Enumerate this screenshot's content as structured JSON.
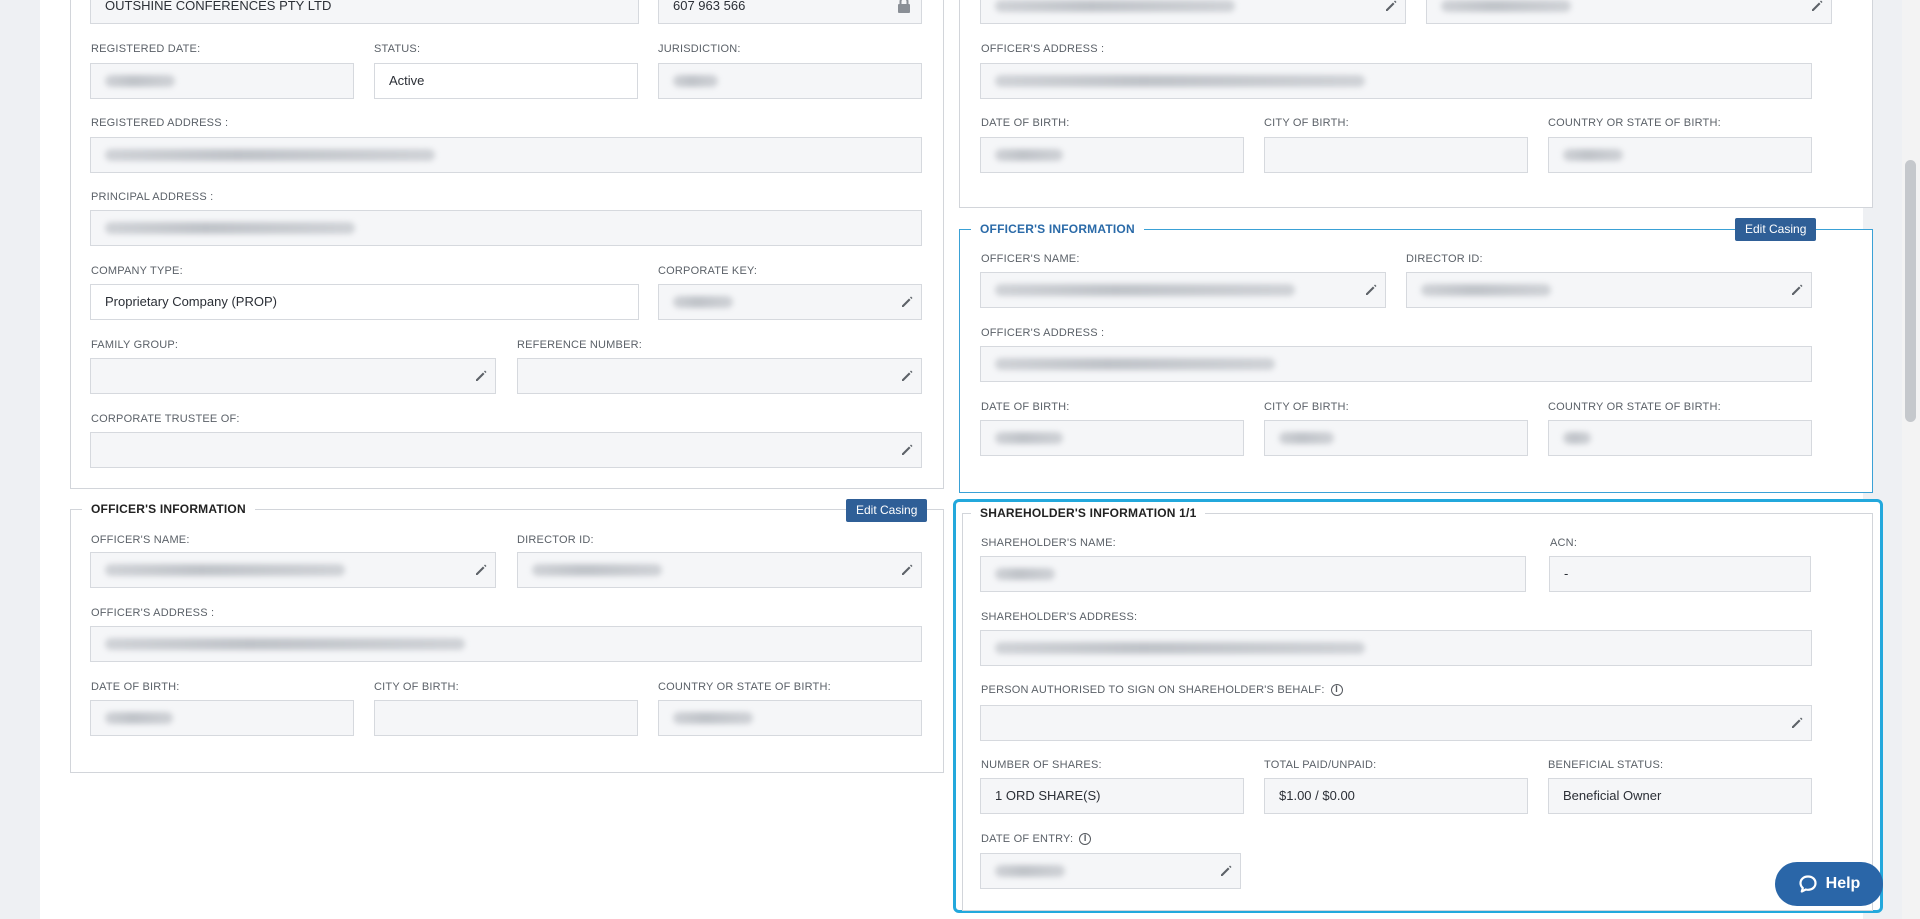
{
  "company": {
    "name_value": "OUTSHINE CONFERENCES PTY LTD",
    "acn_value": "607 963 566",
    "registered_date_label": "REGISTERED DATE:",
    "status_label": "STATUS:",
    "status_value": "Active",
    "jurisdiction_label": "JURISDICTION:",
    "registered_address_label": "REGISTERED ADDRESS :",
    "principal_address_label": "PRINCIPAL ADDRESS :",
    "company_type_label": "COMPANY TYPE:",
    "company_type_value": "Proprietary Company (PROP)",
    "corporate_key_label": "CORPORATE KEY:",
    "family_group_label": "FAMILY GROUP:",
    "reference_number_label": "REFERENCE NUMBER:",
    "corporate_trustee_label": "CORPORATE TRUSTEE OF:"
  },
  "officer_left": {
    "legend": "OFFICER'S INFORMATION",
    "edit_casing": "Edit Casing",
    "name_label": "OFFICER'S NAME:",
    "director_id_label": "DIRECTOR ID:",
    "address_label": "OFFICER'S ADDRESS :",
    "dob_label": "DATE OF BIRTH:",
    "city_label": "CITY OF BIRTH:",
    "country_label": "COUNTRY OR STATE OF BIRTH:"
  },
  "officer_top_right": {
    "address_label": "OFFICER'S ADDRESS :",
    "dob_label": "DATE OF BIRTH:",
    "city_label": "CITY OF BIRTH:",
    "country_label": "COUNTRY OR STATE OF BIRTH:"
  },
  "officer_right": {
    "legend": "OFFICER'S INFORMATION",
    "edit_casing": "Edit Casing",
    "name_label": "OFFICER'S NAME:",
    "director_id_label": "DIRECTOR ID:",
    "address_label": "OFFICER'S ADDRESS :",
    "dob_label": "DATE OF BIRTH:",
    "city_label": "CITY OF BIRTH:",
    "country_label": "COUNTRY OR STATE OF BIRTH:"
  },
  "shareholder": {
    "legend": "SHAREHOLDER'S INFORMATION 1/1",
    "name_label": "SHAREHOLDER'S NAME:",
    "acn_label": "ACN:",
    "acn_value": "-",
    "address_label": "SHAREHOLDER'S ADDRESS:",
    "authorised_label": "PERSON AUTHORISED TO SIGN ON SHAREHOLDER'S BEHALF:",
    "shares_label": "NUMBER OF SHARES:",
    "shares_value": "1 ORD SHARE(S)",
    "paid_label": "TOTAL PAID/UNPAID:",
    "paid_value": "$1.00 / $0.00",
    "beneficial_label": "BENEFICIAL STATUS:",
    "beneficial_value": "Beneficial Owner",
    "entry_label": "DATE OF ENTRY:"
  },
  "help": {
    "label": "Help"
  },
  "colors": {
    "accent": "#2f5f97",
    "highlight": "#23a8dc",
    "legend_blue": "#2a6aa8"
  },
  "icons": [
    "pencil-icon",
    "lock-icon",
    "info-icon",
    "chat-icon"
  ]
}
